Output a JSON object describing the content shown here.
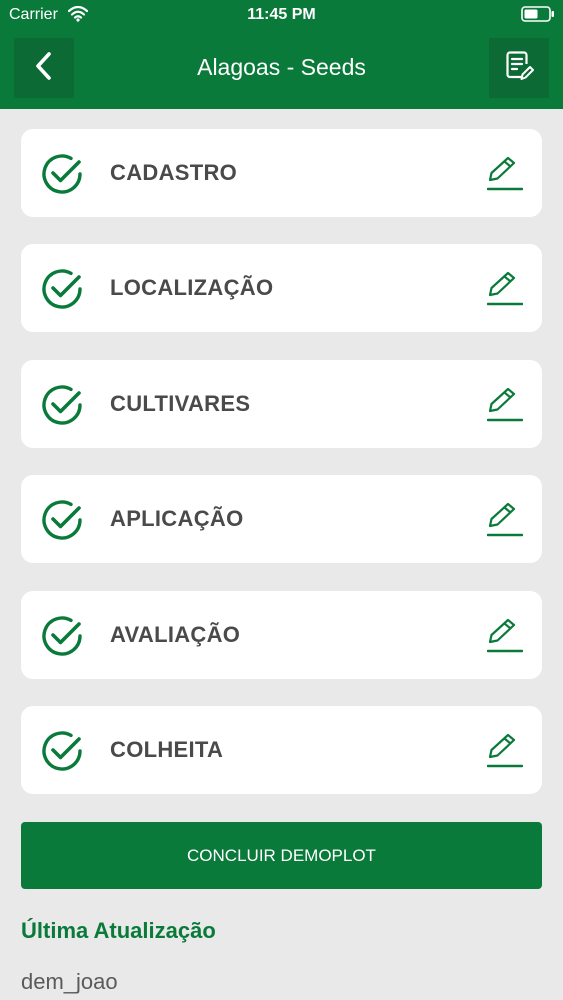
{
  "status_bar": {
    "carrier": "Carrier",
    "time": "11:45 PM"
  },
  "header": {
    "title": "Alagoas - Seeds",
    "back_icon": "chevron-left-icon",
    "notes_icon": "notes-edit-icon"
  },
  "sections": [
    {
      "label": "CADASTRO",
      "status_icon": "check-circle-icon",
      "action_icon": "edit-icon"
    },
    {
      "label": "LOCALIZAÇÃO",
      "status_icon": "check-circle-icon",
      "action_icon": "edit-icon"
    },
    {
      "label": "CULTIVARES",
      "status_icon": "check-circle-icon",
      "action_icon": "edit-icon"
    },
    {
      "label": "APLICAÇÃO",
      "status_icon": "check-circle-icon",
      "action_icon": "edit-icon"
    },
    {
      "label": "AVALIAÇÃO",
      "status_icon": "check-circle-icon",
      "action_icon": "edit-icon"
    },
    {
      "label": "COLHEITA",
      "status_icon": "check-circle-icon",
      "action_icon": "edit-icon"
    }
  ],
  "conclude_button": {
    "label": "CONCLUIR DEMOPLOT"
  },
  "last_update": {
    "heading": "Última Atualização",
    "user": "dem_joao"
  },
  "colors": {
    "primary": "#0a7a3b",
    "background": "#e9e9e9",
    "card": "#ffffff",
    "text": "#4a4a4a"
  }
}
